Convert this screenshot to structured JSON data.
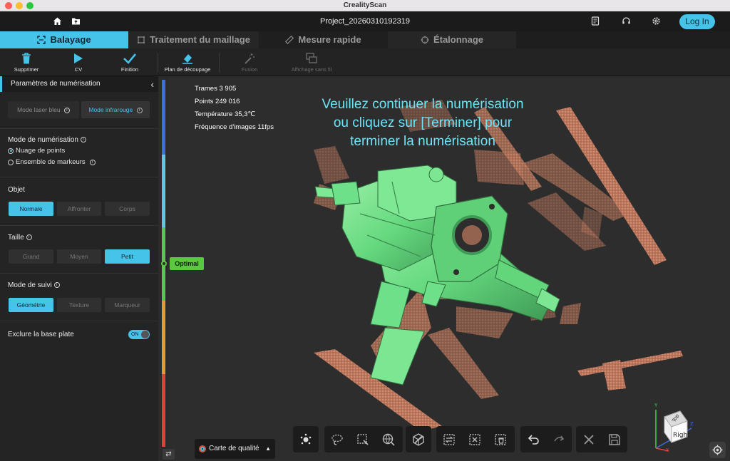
{
  "window": {
    "title": "CrealityScan"
  },
  "header": {
    "project": "Project_20260310192319",
    "login_label": "Log In"
  },
  "tabs": [
    {
      "label": "Balayage",
      "icon": "scan-icon"
    },
    {
      "label": "Traitement du maillage",
      "icon": "mesh-icon"
    },
    {
      "label": "Mesure rapide",
      "icon": "ruler-icon"
    },
    {
      "label": "Étalonnage",
      "icon": "crosshair-icon"
    }
  ],
  "toolbar": {
    "items": [
      {
        "label": "Supprimer",
        "icon": "trash-icon",
        "enabled": true
      },
      {
        "label": "CV",
        "icon": "play-icon",
        "enabled": true
      },
      {
        "label": "Finition",
        "icon": "check-icon",
        "enabled": true
      },
      {
        "label": "Plan de découpage",
        "icon": "eraser-icon",
        "enabled": true
      },
      {
        "label": "Fusion",
        "icon": "magic-wand-icon",
        "enabled": false
      },
      {
        "label": "Affichage sans fil",
        "icon": "screen-mirror-icon",
        "enabled": false
      }
    ]
  },
  "panel": {
    "title": "Paramètres de numérisation",
    "device_modes": [
      "Mode laser bleu",
      "Mode infrarouge"
    ],
    "device_mode_selected": "Mode infrarouge",
    "scan_mode_title": "Mode de numérisation",
    "scan_mode_options": [
      "Nuage de points",
      "Ensemble de markeurs"
    ],
    "scan_mode_selected": "Nuage de points",
    "object_title": "Objet",
    "object_options": [
      "Normale",
      "Affronter",
      "Corps"
    ],
    "object_selected": "Normale",
    "size_title": "Taille",
    "size_options": [
      "Grand",
      "Moyen",
      "Petit"
    ],
    "size_selected": "Petit",
    "tracking_title": "Mode de suivi",
    "tracking_options": [
      "Géométrie",
      "Texture",
      "Marqueur"
    ],
    "tracking_selected": "Géométrie",
    "exclude_label": "Exclure la base plate",
    "exclude_toggle": "ON"
  },
  "quality": {
    "label": "Optimal",
    "colors": {
      "blue": "#3f6fd8",
      "cyan": "#5fc8e0",
      "green": "#58c84a",
      "orange": "#e39b31",
      "red": "#d9453b"
    }
  },
  "stats": {
    "frames": "Trames 3 905",
    "points": "Points 249 016",
    "temperature": "Température 35,3℃",
    "fps": "Fréquence d'images 11fps"
  },
  "message": {
    "line1": "Veuillez continuer la numérisation",
    "line2": "ou cliquez sur [Terminer] pour",
    "line3": "terminer la numérisation"
  },
  "bottom": {
    "quality_map": "Carte de qualité",
    "gizmo_face_top": "Top",
    "gizmo_face_right": "Right"
  },
  "colors": {
    "accent": "#45c3e8",
    "model": "#6fe08a",
    "points": "#e08a6a"
  }
}
